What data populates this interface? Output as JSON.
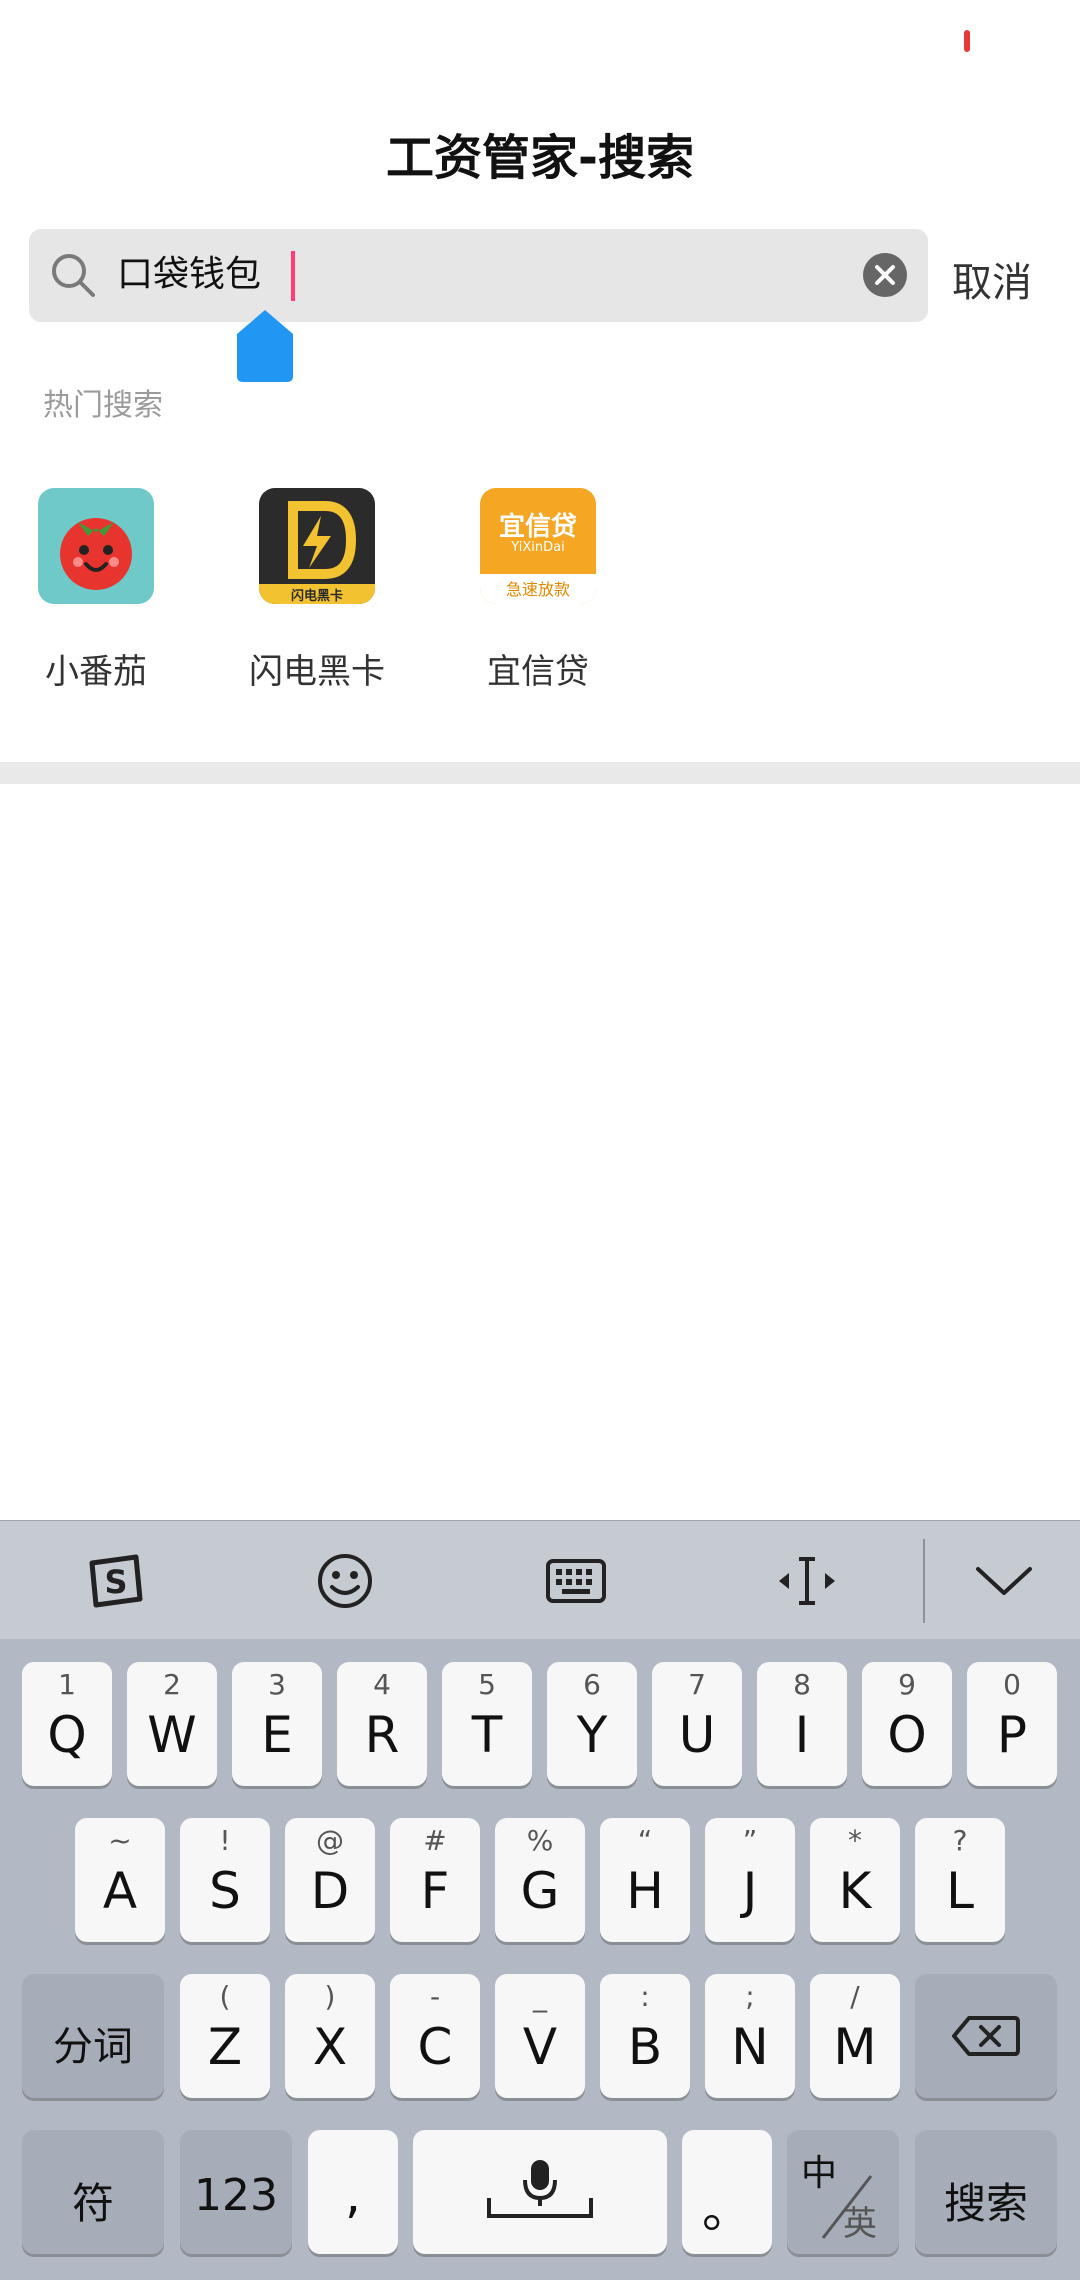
{
  "page": {
    "title": "工资管家-搜索"
  },
  "search": {
    "value": "口袋钱包",
    "cancel_label": "取消"
  },
  "hot": {
    "title": "热门搜索",
    "apps": [
      {
        "name": "小番茄",
        "icon": "tomato-app-icon",
        "color": "#6fc9c9"
      },
      {
        "name": "闪电黑卡",
        "icon": "lightning-card-app-icon",
        "color": "#2b2b2b"
      },
      {
        "name": "宜信贷",
        "icon": "yixindai-app-icon",
        "color": "#f5a623",
        "icon_text": "宜信贷",
        "icon_subtext": "YiXinDai",
        "icon_footer": "急速放款"
      }
    ],
    "app_badges": {
      "shandian_footer": "闪电黑卡"
    }
  },
  "keyboard": {
    "toolbar": [
      "sogou-logo-icon",
      "emoji-icon",
      "keyboard-icon",
      "cursor-move-icon",
      "collapse-chevron-icon"
    ],
    "row1": [
      {
        "main": "Q",
        "hint": "1"
      },
      {
        "main": "W",
        "hint": "2"
      },
      {
        "main": "E",
        "hint": "3"
      },
      {
        "main": "R",
        "hint": "4"
      },
      {
        "main": "T",
        "hint": "5"
      },
      {
        "main": "Y",
        "hint": "6"
      },
      {
        "main": "U",
        "hint": "7"
      },
      {
        "main": "I",
        "hint": "8"
      },
      {
        "main": "O",
        "hint": "9"
      },
      {
        "main": "P",
        "hint": "0"
      }
    ],
    "row2": [
      {
        "main": "A",
        "hint": "~"
      },
      {
        "main": "S",
        "hint": "!"
      },
      {
        "main": "D",
        "hint": "@"
      },
      {
        "main": "F",
        "hint": "#"
      },
      {
        "main": "G",
        "hint": "%"
      },
      {
        "main": "H",
        "hint": "“"
      },
      {
        "main": "J",
        "hint": "”"
      },
      {
        "main": "K",
        "hint": "*"
      },
      {
        "main": "L",
        "hint": "?"
      }
    ],
    "row3": [
      {
        "main": "Z",
        "hint": "("
      },
      {
        "main": "X",
        "hint": ")"
      },
      {
        "main": "C",
        "hint": "-"
      },
      {
        "main": "V",
        "hint": "_"
      },
      {
        "main": "B",
        "hint": ":"
      },
      {
        "main": "N",
        "hint": ";"
      },
      {
        "main": "M",
        "hint": "/"
      }
    ],
    "fenci_label": "分词",
    "fu_label": "符",
    "num_label": "123",
    "comma_label": ",",
    "period_label": "。",
    "lang_top": "中",
    "lang_bottom": "英",
    "search_label": "搜索"
  }
}
